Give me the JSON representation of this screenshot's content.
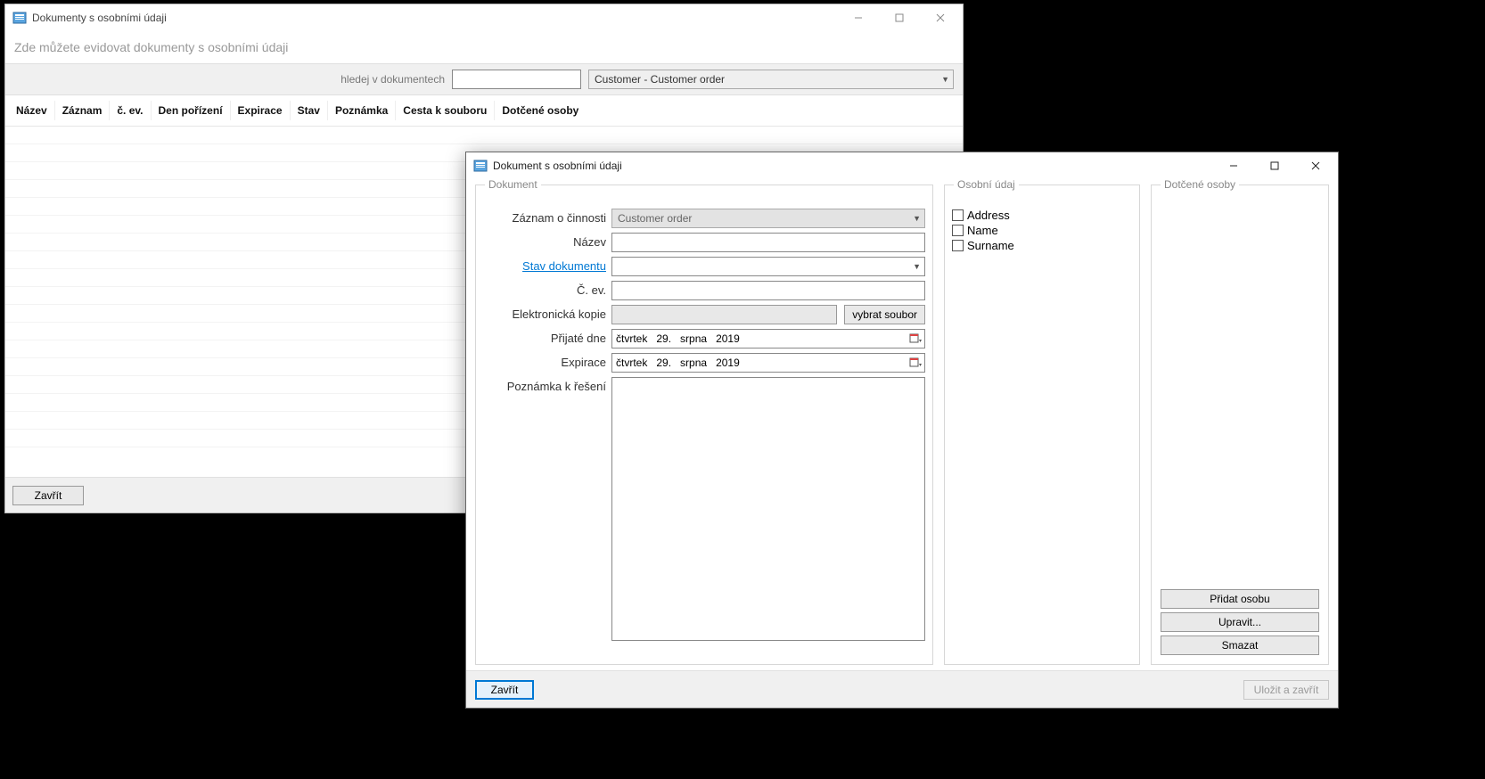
{
  "window1": {
    "title": "Dokumenty s osobními údaji",
    "subtitle": "Zde můžete evidovat dokumenty s osobními údaji",
    "search_label": "hledej v dokumentech",
    "dropdown_value": "Customer - Customer order",
    "columns": [
      "Název",
      "Záznam",
      "č. ev.",
      "Den pořízení",
      "Expirace",
      "Stav",
      "Poznámka",
      "Cesta k souboru",
      "Dotčené osoby"
    ],
    "close_button": "Zavřít"
  },
  "window2": {
    "title": "Dokument s osobními údaji",
    "group_dokument": "Dokument",
    "group_osobni": "Osobní údaj",
    "group_dotcene": "Dotčené osoby",
    "labels": {
      "zaznam": "Záznam o činnosti",
      "nazev": "Název",
      "stav": "Stav dokumentu",
      "cev": "Č. ev.",
      "kopie": "Elektronická kopie",
      "prijate": "Přijaté dne",
      "expirace": "Expirace",
      "poznamka": "Poznámka k řešení"
    },
    "zaznam_value": "Customer order",
    "file_button": "vybrat soubor",
    "date1": {
      "dow": "čtvrtek",
      "day": "29.",
      "month": "srpna",
      "year": "2019"
    },
    "date2": {
      "dow": "čtvrtek",
      "day": "29.",
      "month": "srpna",
      "year": "2019"
    },
    "osobni_items": [
      "Address",
      "Name",
      "Surname"
    ],
    "dotcene_buttons": {
      "add": "Přidat osobu",
      "edit": "Upravit...",
      "delete": "Smazat"
    },
    "footer": {
      "close": "Zavřít",
      "save": "Uložit a zavřít"
    }
  }
}
